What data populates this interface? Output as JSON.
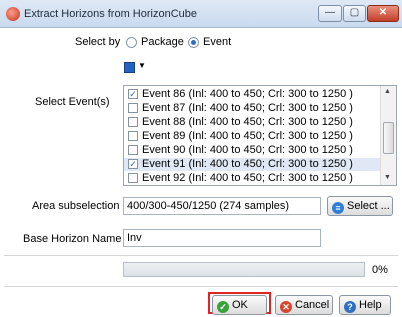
{
  "window": {
    "title": "Extract Horizons from HorizonCube",
    "min": "—",
    "max": "▢",
    "close": "✕"
  },
  "select_by": {
    "label": "Select by",
    "options": [
      "Package",
      "Event"
    ],
    "selected": "Event"
  },
  "events": {
    "label": "Select Event(s)",
    "items": [
      {
        "text": "Event 86  (Inl: 400 to 450; Crl: 300 to 1250 )",
        "checked": true
      },
      {
        "text": "Event 87  (Inl: 400 to 450; Crl: 300 to 1250 )",
        "checked": false
      },
      {
        "text": "Event 88  (Inl: 400 to 450; Crl: 300 to 1250 )",
        "checked": false
      },
      {
        "text": "Event 89  (Inl: 400 to 450; Crl: 300 to 1250 )",
        "checked": false
      },
      {
        "text": "Event 90  (Inl: 400 to 450; Crl: 300 to 1250 )",
        "checked": false
      },
      {
        "text": "Event 91  (Inl: 400 to 450; Crl: 300 to 1250 )",
        "checked": true
      },
      {
        "text": "Event 92  (Inl: 400 to 450; Crl: 300 to 1250 )",
        "checked": false
      }
    ]
  },
  "area": {
    "label": "Area subselection",
    "value": "400/300-450/1250 (274 samples)",
    "button": "Select ..."
  },
  "base_horizon": {
    "label": "Base Horizon Name",
    "value": "Inv"
  },
  "progress": {
    "value": 0,
    "text": "0%"
  },
  "buttons": {
    "ok": "OK",
    "cancel": "Cancel",
    "help": "Help"
  },
  "colors": {
    "accent": "#2463c6",
    "highlight": "#e02424"
  }
}
